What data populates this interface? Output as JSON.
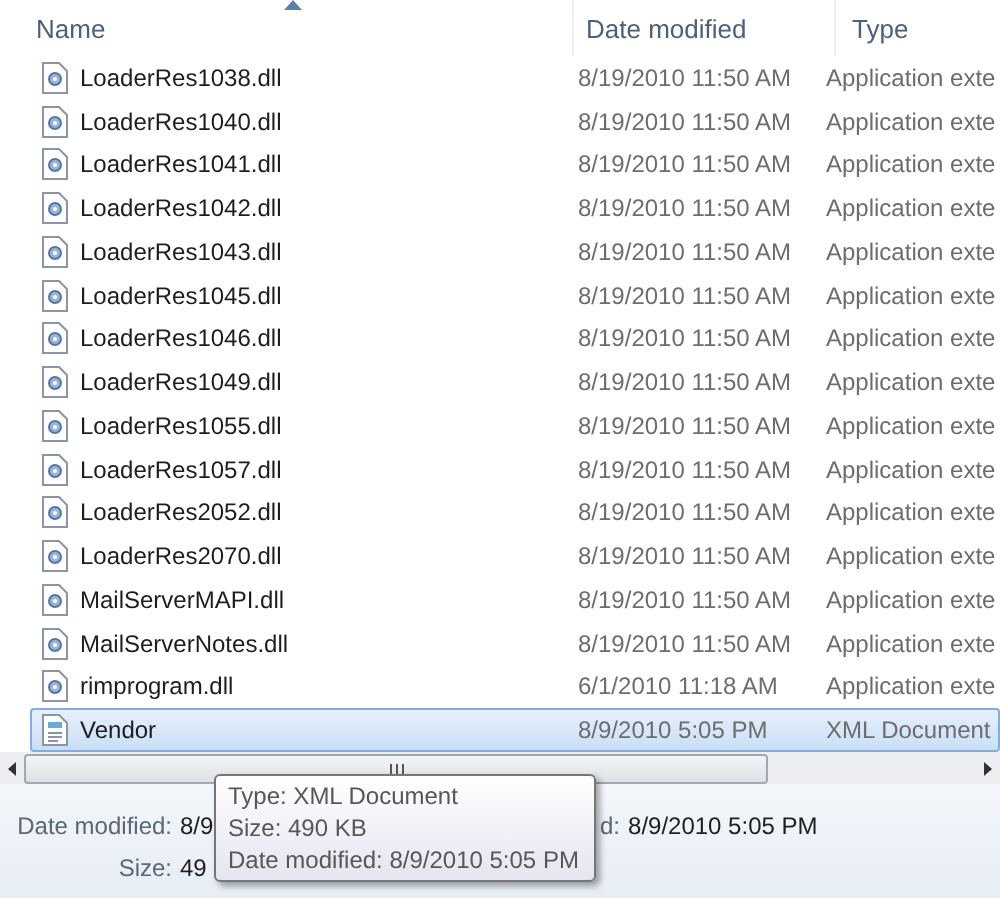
{
  "columns": [
    {
      "label": "Name",
      "sorted": true
    },
    {
      "label": "Date modified",
      "sorted": false
    },
    {
      "label": "Type",
      "sorted": false
    }
  ],
  "files": [
    {
      "name": "LoaderRes1038.dll",
      "date": "8/19/2010 11:50 AM",
      "type": "Application exte",
      "kind": "dll",
      "selected": false
    },
    {
      "name": "LoaderRes1040.dll",
      "date": "8/19/2010 11:50 AM",
      "type": "Application exte",
      "kind": "dll",
      "selected": false
    },
    {
      "name": "LoaderRes1041.dll",
      "date": "8/19/2010 11:50 AM",
      "type": "Application exte",
      "kind": "dll",
      "selected": false
    },
    {
      "name": "LoaderRes1042.dll",
      "date": "8/19/2010 11:50 AM",
      "type": "Application exte",
      "kind": "dll",
      "selected": false
    },
    {
      "name": "LoaderRes1043.dll",
      "date": "8/19/2010 11:50 AM",
      "type": "Application exte",
      "kind": "dll",
      "selected": false
    },
    {
      "name": "LoaderRes1045.dll",
      "date": "8/19/2010 11:50 AM",
      "type": "Application exte",
      "kind": "dll",
      "selected": false
    },
    {
      "name": "LoaderRes1046.dll",
      "date": "8/19/2010 11:50 AM",
      "type": "Application exte",
      "kind": "dll",
      "selected": false
    },
    {
      "name": "LoaderRes1049.dll",
      "date": "8/19/2010 11:50 AM",
      "type": "Application exte",
      "kind": "dll",
      "selected": false
    },
    {
      "name": "LoaderRes1055.dll",
      "date": "8/19/2010 11:50 AM",
      "type": "Application exte",
      "kind": "dll",
      "selected": false
    },
    {
      "name": "LoaderRes1057.dll",
      "date": "8/19/2010 11:50 AM",
      "type": "Application exte",
      "kind": "dll",
      "selected": false
    },
    {
      "name": "LoaderRes2052.dll",
      "date": "8/19/2010 11:50 AM",
      "type": "Application exte",
      "kind": "dll",
      "selected": false
    },
    {
      "name": "LoaderRes2070.dll",
      "date": "8/19/2010 11:50 AM",
      "type": "Application exte",
      "kind": "dll",
      "selected": false
    },
    {
      "name": "MailServerMAPI.dll",
      "date": "8/19/2010 11:50 AM",
      "type": "Application exte",
      "kind": "dll",
      "selected": false
    },
    {
      "name": "MailServerNotes.dll",
      "date": "8/19/2010 11:50 AM",
      "type": "Application exte",
      "kind": "dll",
      "selected": false
    },
    {
      "name": "rimprogram.dll",
      "date": "6/1/2010 11:18 AM",
      "type": "Application exte",
      "kind": "dll",
      "selected": false
    },
    {
      "name": "Vendor",
      "date": "8/9/2010 5:05 PM",
      "type": "XML Document",
      "kind": "xml",
      "selected": true
    }
  ],
  "details": [
    {
      "label": "Date modified:",
      "value": "8/9",
      "right_label": "d:",
      "right_value": "8/9/2010 5:05 PM"
    },
    {
      "label": "Size:",
      "value": "49"
    }
  ],
  "tooltip": [
    "Type: XML Document",
    "Size: 490 KB",
    "Date modified: 8/9/2010 5:05 PM"
  ]
}
